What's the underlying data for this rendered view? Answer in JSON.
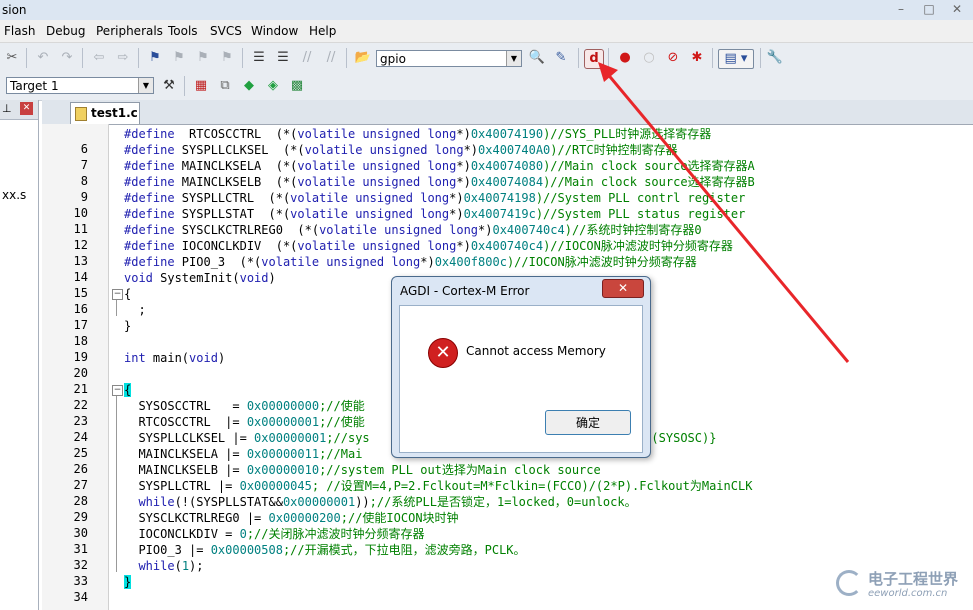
{
  "window": {
    "title_fragment": "sion",
    "controls": [
      "–",
      "□",
      "✕"
    ]
  },
  "menu": [
    "Flash",
    "Debug",
    "Peripherals",
    "Tools",
    "SVCS",
    "Window",
    "Help"
  ],
  "toolbar": {
    "find_combo": "gpio"
  },
  "build_toolbar": {
    "target_combo": "Target 1"
  },
  "left_pane": {
    "pin_icon": "⊥",
    "close_icon": "✕",
    "file_fragment": "xx.s"
  },
  "editor": {
    "tab_label": "test1.c",
    "lines": [
      {
        "n": "",
        "t": [
          [
            "kw",
            "#define"
          ],
          [
            "",
            "  RTCOSCCTRL  (*("
          ],
          [
            "kw",
            "volatile unsigned long"
          ],
          [
            "",
            "*)"
          ],
          [
            "num",
            "0x40074190"
          ],
          [
            "cm",
            ")//SYS_PLL时钟源选择寄存器"
          ]
        ]
      },
      {
        "n": "6",
        "t": [
          [
            "kw",
            "#define"
          ],
          [
            "",
            " SYSPLLCLKSEL  (*("
          ],
          [
            "kw",
            "volatile unsigned long"
          ],
          [
            "",
            "*)"
          ],
          [
            "num",
            "0x400740A0"
          ],
          [
            "cm",
            ")//RTC时钟控制寄存器"
          ]
        ]
      },
      {
        "n": "7",
        "t": [
          [
            "kw",
            "#define"
          ],
          [
            "",
            " MAINCLKSELA  (*("
          ],
          [
            "kw",
            "volatile unsigned long"
          ],
          [
            "",
            "*)"
          ],
          [
            "num",
            "0x40074080"
          ],
          [
            "cm",
            ")//Main clock source选择寄存器A"
          ]
        ]
      },
      {
        "n": "8",
        "t": [
          [
            "kw",
            "#define"
          ],
          [
            "",
            " MAINCLKSELB  (*("
          ],
          [
            "kw",
            "volatile unsigned long"
          ],
          [
            "",
            "*)"
          ],
          [
            "num",
            "0x40074084"
          ],
          [
            "cm",
            ")//Main clock source选择寄存器B"
          ]
        ]
      },
      {
        "n": "9",
        "t": [
          [
            "kw",
            "#define"
          ],
          [
            "",
            " SYSPLLCTRL  (*("
          ],
          [
            "kw",
            "volatile unsigned long"
          ],
          [
            "",
            "*)"
          ],
          [
            "num",
            "0x40074198"
          ],
          [
            "cm",
            ")//System PLL contrl register"
          ]
        ]
      },
      {
        "n": "10",
        "t": [
          [
            "kw",
            "#define"
          ],
          [
            "",
            " SYSPLLSTAT  (*("
          ],
          [
            "kw",
            "volatile unsigned long"
          ],
          [
            "",
            "*)"
          ],
          [
            "num",
            "0x4007419c"
          ],
          [
            "cm",
            ")//System PLL status register"
          ]
        ]
      },
      {
        "n": "11",
        "t": [
          [
            "kw",
            "#define"
          ],
          [
            "",
            " SYSCLKCTRLREG0  (*("
          ],
          [
            "kw",
            "volatile unsigned long"
          ],
          [
            "",
            "*)"
          ],
          [
            "num",
            "0x400740c4"
          ],
          [
            "cm",
            ")//系统时钟控制寄存器0"
          ]
        ]
      },
      {
        "n": "12",
        "t": [
          [
            "kw",
            "#define"
          ],
          [
            "",
            " IOCONCLKDIV  (*("
          ],
          [
            "kw",
            "volatile unsigned long"
          ],
          [
            "",
            "*)"
          ],
          [
            "num",
            "0x400740c4"
          ],
          [
            "cm",
            ")//IOCON脉冲滤波时钟分频寄存器"
          ]
        ]
      },
      {
        "n": "13",
        "t": [
          [
            "kw",
            "#define"
          ],
          [
            "",
            " PIO0_3  (*("
          ],
          [
            "kw",
            "volatile unsigned long"
          ],
          [
            "",
            "*)"
          ],
          [
            "num",
            "0x400f800c"
          ],
          [
            "cm",
            ")//IOCON脉冲滤波时钟分频寄存器"
          ]
        ]
      },
      {
        "n": "14",
        "t": [
          [
            "kw",
            "void"
          ],
          [
            "",
            " SystemInit("
          ],
          [
            "kw",
            "void"
          ],
          [
            "",
            ")"
          ]
        ]
      },
      {
        "n": "15",
        "fold": "minus",
        "t": [
          [
            "",
            "{"
          ]
        ]
      },
      {
        "n": "16",
        "t": [
          [
            "",
            "  ;"
          ]
        ]
      },
      {
        "n": "17",
        "t": [
          [
            "",
            "}"
          ]
        ]
      },
      {
        "n": "18",
        "t": []
      },
      {
        "n": "19",
        "t": [
          [
            "kw",
            "int"
          ],
          [
            "",
            " main("
          ],
          [
            "kw",
            "void"
          ],
          [
            "",
            ")"
          ]
        ]
      },
      {
        "n": "20",
        "t": []
      },
      {
        "n": "21",
        "fold": "minus",
        "t": [
          [
            "brk",
            "{"
          ]
        ]
      },
      {
        "n": "22",
        "t": [
          [
            "",
            "  SYSOSCCTRL   = "
          ],
          [
            "num",
            "0x00000000"
          ],
          [
            "cm",
            ";//使能"
          ]
        ]
      },
      {
        "n": "23",
        "t": [
          [
            "",
            "  RTCOSCCTRL  |= "
          ],
          [
            "num",
            "0x00000001"
          ],
          [
            "cm",
            ";//使能"
          ]
        ]
      },
      {
        "n": "24",
        "t": [
          [
            "",
            "  SYSPLLCLKSEL |= "
          ],
          [
            "num",
            "0x00000001"
          ],
          [
            "cm",
            ";//sys"
          ],
          [
            "cm",
            "                            Crystal OSC(SYSOSC)}"
          ]
        ]
      },
      {
        "n": "25",
        "t": [
          [
            "",
            "  MAINCLKSELA |= "
          ],
          [
            "num",
            "0x00000011"
          ],
          [
            "cm",
            ";//Mai"
          ]
        ]
      },
      {
        "n": "26",
        "t": [
          [
            "",
            "  MAINCLKSELB |= "
          ],
          [
            "num",
            "0x00000010"
          ],
          [
            "cm",
            ";//system PLL out选择为Main clock source"
          ]
        ]
      },
      {
        "n": "27",
        "t": [
          [
            "",
            "  SYSPLLCTRL |= "
          ],
          [
            "num",
            "0x00000045"
          ],
          [
            "cm",
            "; //设置M=4,P=2.Fclkout=M*Fclkin=(FCCO)/(2*P).Fclkout为MainCLK"
          ]
        ]
      },
      {
        "n": "28",
        "t": [
          [
            "kw",
            "  while"
          ],
          [
            "",
            "(!(SYSPLLSTAT&&"
          ],
          [
            "num",
            "0x00000001"
          ],
          [
            "",
            "))"
          ],
          [
            "cm",
            ";//系统PLL是否锁定，1=locked，0=unlock。"
          ]
        ]
      },
      {
        "n": "29",
        "t": [
          [
            "",
            "  SYSCLKCTRLREG0 |= "
          ],
          [
            "num",
            "0x00000200"
          ],
          [
            "cm",
            ";//使能IOCON块时钟"
          ]
        ]
      },
      {
        "n": "30",
        "t": [
          [
            "",
            "  IOCONCLKDIV = "
          ],
          [
            "num",
            "0"
          ],
          [
            "cm",
            ";//关闭脉冲滤波时钟分频寄存器"
          ]
        ]
      },
      {
        "n": "31",
        "t": [
          [
            "",
            "  PIO0_3 |= "
          ],
          [
            "num",
            "0x00000508"
          ],
          [
            "cm",
            ";//开漏模式，下拉电阻，滤波旁路，PCLK。"
          ]
        ]
      },
      {
        "n": "32",
        "t": [
          [
            "kw",
            "  while"
          ],
          [
            "",
            "("
          ],
          [
            "num",
            "1"
          ],
          [
            "",
            ");"
          ]
        ]
      },
      {
        "n": "33",
        "t": [
          [
            "brk",
            "}"
          ]
        ]
      },
      {
        "n": "34",
        "t": []
      }
    ]
  },
  "dialog": {
    "title": "AGDI - Cortex-M Error",
    "close_label": "✕",
    "message": "Cannot access Memory",
    "ok_label": "确定"
  },
  "watermark": {
    "line1": "电子工程世界",
    "line2": "eeworld.com.cn"
  },
  "colors": {
    "keyword": "#2020b0",
    "number": "#008080",
    "comment": "#008000",
    "arrow": "#e8262a",
    "bracket_highlight": "#00e0e0"
  }
}
